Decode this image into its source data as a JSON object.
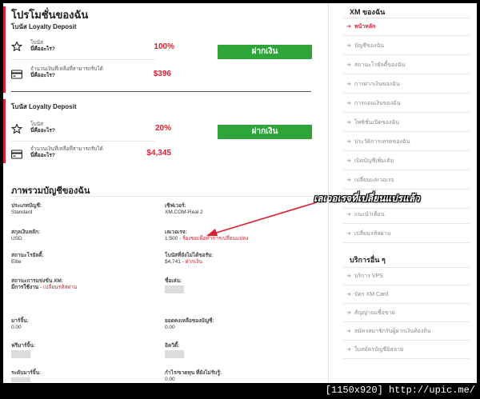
{
  "promotions": {
    "title": "โปรโมชั่นของฉัน",
    "blocks": [
      {
        "title": "โบนัส Loyalty Deposit",
        "bonus_label": "โบนัส",
        "bonus_question": "นี่คืออะไร?",
        "bonus_value": "100%",
        "amount_label": "จำนวนเงินที่เหลือที่สามารถรับได้",
        "amount_question": "นี่คืออะไร?",
        "amount_value": "$396",
        "deposit_button": "ฝากเงิน"
      },
      {
        "title": "โบนัส Loyalty Deposit",
        "bonus_label": "โบนัส",
        "bonus_question": "นี่คืออะไร?",
        "bonus_value": "20%",
        "amount_label": "จำนวนเงินที่เหลือที่สามารถรับได้",
        "amount_question": "นี่คืออะไร?",
        "amount_value": "$4,345",
        "deposit_button": "ฝากเงิน"
      }
    ]
  },
  "summary": {
    "title": "ภาพรวมบัญชีของฉัน",
    "account_type_label": "ประเภทบัญชี:",
    "account_type_value": "Standard",
    "server_label": "เซิฟเวอร์:",
    "server_value": "XM.COM-Real 2",
    "currency_label": "สกุลเงินหลัก:",
    "currency_value": "USD",
    "leverage_label": "เลเวอเรจ:",
    "leverage_value": "1:500",
    "leverage_link": "ร้องขอเพื่อทำการเปลี่ยนแปลง",
    "status_label": "สถานะโรยัลตี้:",
    "status_value": "Elite",
    "unclaimed_label": "โบนัสที่ยังไม่ได้ขอรับ:",
    "unclaimed_value": "$4,741",
    "unclaimed_link": "ฝากเงิน",
    "competition_label": "สถานะการแข่งขัน XM:",
    "competition_value": "มีการใช้งาน",
    "competition_link": "เปลี่ยนรหัสผ่าน",
    "nickname_label": "ชื่อเล่น:",
    "margin_label": "มาร์จิ้น:",
    "margin_value": "0.00",
    "balance_label": "ยอดคงเหลือของบัญชี:",
    "balance_value": "0.00",
    "free_margin_label": "ฟรีมาร์จิ้น:",
    "equity_label": "อิควิตี้:",
    "margin_level_label": "ระดับมาร์จิ้น:",
    "unrealized_label": "กำไร/ขาดทุน ที่ยังไม่รับรู้:",
    "unrealized_value": "0.00"
  },
  "annotation": {
    "text": "เลเวอเรจที่เปลี่ยนแปรแล้ว"
  },
  "sidebar": {
    "title": "XM ของฉัน",
    "items": [
      "หน้าหลัก",
      "บัญชีของฉัน",
      "สถานะโรยัลตี้ของฉัน",
      "การฝากเงินของฉัน",
      "การถอนเงินของฉัน",
      "โพซิชั่นเปิดของฉัน",
      "ประวัติการเทรดของฉัน",
      "เปิดบัญชีเพิ่มเติม",
      "เปลี่ยนแลเวอเรจ",
      "",
      "แนะนำเพื่อน",
      "เปลี่ยนรหัสผ่าน"
    ],
    "other_title": "บริการอื่น ๆ",
    "other_items": [
      "บริการ VPS",
      "บัตร XM Card",
      "สัญญาณเชื่อขาย",
      "สมัครสมาชิกรับผู้ฝากเงินท้องถิ่น",
      "ใบสมัครบัญชีอิสลาม"
    ],
    "colors": {
      "accent": "#d8202f",
      "button": "#2ea43a"
    }
  },
  "watermark": "[1150x920] http://upic.me/"
}
